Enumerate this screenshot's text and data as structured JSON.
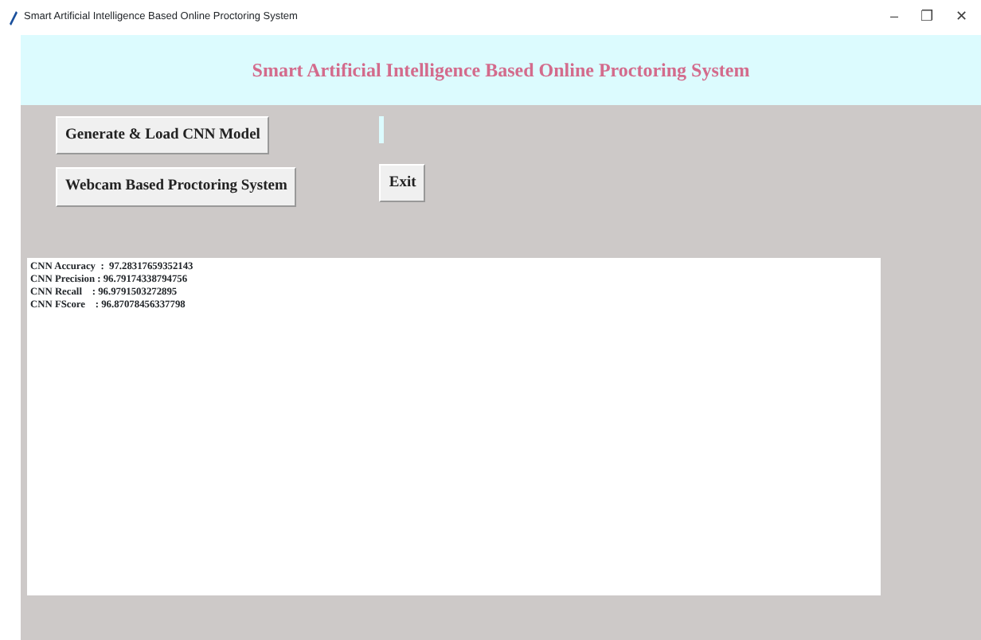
{
  "window": {
    "title": "Smart Artificial Intelligence Based Online Proctoring System",
    "controls": [
      "–",
      "❐",
      "✕"
    ]
  },
  "header": {
    "title": "Smart Artificial Intelligence Based Online Proctoring System"
  },
  "buttons": [
    {
      "label": "Generate & Load CNN Model"
    },
    {
      "label": "Webcam Based Proctoring System"
    },
    {
      "label": "Exit"
    }
  ],
  "output": {
    "lines": [
      "CNN Accuracy  :  97.28317659352143",
      "CNN Precision : 96.79174338794756",
      "CNN Recall    : 96.9791503272895",
      "CNN FScore    : 96.87078456337798"
    ]
  }
}
